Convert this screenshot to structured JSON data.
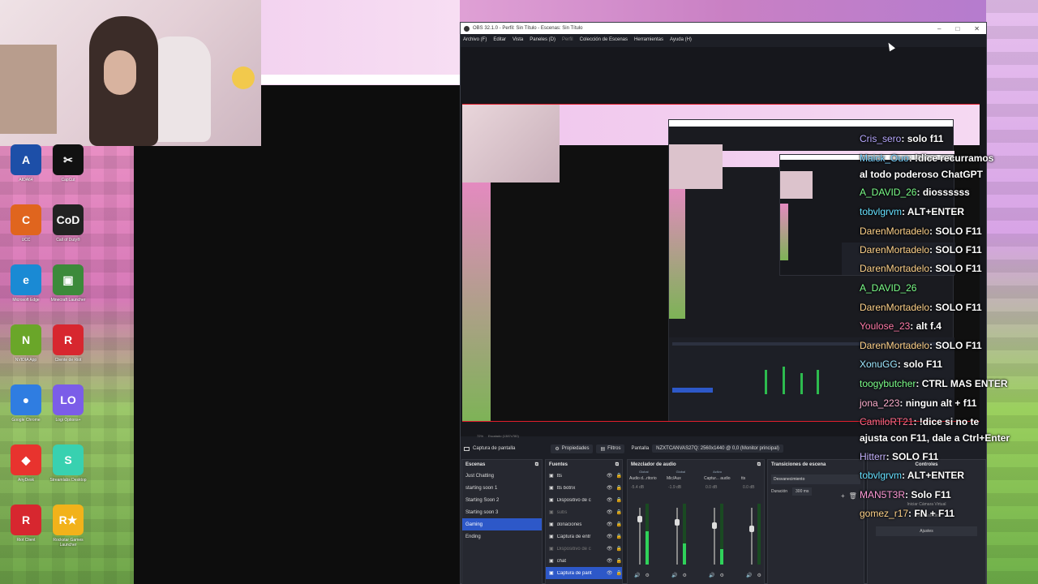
{
  "obs": {
    "title": "OBS 32.1.0 - Perfil: Sin Título - Escenas: Sin Título",
    "menu": [
      "Archivo (F)",
      "Editar",
      "Vista",
      "Paneles (D)",
      "Perfil",
      "Colección de Escenas",
      "Herramientas",
      "Ayuda (H)"
    ],
    "window_controls": [
      "–",
      "□",
      "✕"
    ],
    "status": [
      "72%",
      "Escalado (1387x780)"
    ],
    "toolbar": {
      "source_name": "Captura de pantalla",
      "properties": "Propiedades",
      "filters": "Filtros",
      "display_label": "Pantalla",
      "display_value": "NZXTCANVAS27Q: 2560x1440 @ 0,0 (Monitor principal)"
    },
    "scenes": {
      "title": "Escenas",
      "items": [
        "Just Chatting",
        "starting soon 1",
        "Starting Soon 2",
        "Starting soon 3",
        "Gaming",
        "Ending"
      ],
      "selected_index": 4
    },
    "sources": {
      "title": "Fuentes",
      "items": [
        {
          "name": "tts",
          "dim": false
        },
        {
          "name": "tts botrix",
          "dim": false
        },
        {
          "name": "Dispositivo de c",
          "dim": false
        },
        {
          "name": "subs",
          "dim": true
        },
        {
          "name": "donaciones",
          "dim": false
        },
        {
          "name": "Captura de entr",
          "dim": false
        },
        {
          "name": "Dispositivo de c",
          "dim": true
        },
        {
          "name": "chat",
          "dim": false
        },
        {
          "name": "Captura de pant",
          "dim": false
        }
      ],
      "selected_index": 8
    },
    "mixer": {
      "title": "Mezclador de audio",
      "tabs": [
        "Global",
        "Global",
        "Activo"
      ],
      "channels": [
        {
          "name": "Audio d...ritorio",
          "db": "-5.4 dB",
          "level": 0.55
        },
        {
          "name": "Mic/Aux",
          "db": "-1.9 dB",
          "level": 0.35
        },
        {
          "name": "Captur... audio",
          "db": "0.0 dB",
          "level": 0.25
        },
        {
          "name": "tts",
          "db": "0.0 dB",
          "level": 0.0
        }
      ]
    },
    "transitions": {
      "title": "Transiciones de escena",
      "type": "Desvanecimiento",
      "duration_label": "Duración",
      "duration_value": "300 ms"
    },
    "controls": {
      "title": "Controles",
      "items": [
        "Iniciar Cámara Virtual",
        "Modo Estudio",
        "Ajustes"
      ]
    }
  },
  "desktop_icons": [
    {
      "label": "AIDA64",
      "color": "#1d4fa8",
      "glyph": "A"
    },
    {
      "label": "CapCut",
      "color": "#111111",
      "glyph": "✂"
    },
    {
      "label": "UCC",
      "color": "#e0651e",
      "glyph": "C"
    },
    {
      "label": "Call of Duty®",
      "color": "#222222",
      "glyph": "CoD"
    },
    {
      "label": "Microsoft Edge",
      "color": "#1a8ad4",
      "glyph": "e"
    },
    {
      "label": "Minecraft Launcher",
      "color": "#3c8a3a",
      "glyph": "▣"
    },
    {
      "label": "NVIDIA App",
      "color": "#6aa629",
      "glyph": "N"
    },
    {
      "label": "Cliente de Riot",
      "color": "#d7272f",
      "glyph": "R"
    },
    {
      "label": "Google Chrome",
      "color": "#2f7de1",
      "glyph": "●"
    },
    {
      "label": "Logi Options+",
      "color": "#7b5de8",
      "glyph": "LO"
    },
    {
      "label": "AnyDesk",
      "color": "#e8332e",
      "glyph": "◆"
    },
    {
      "label": "Streamlabs Desktop",
      "color": "#38d1b0",
      "glyph": "S"
    },
    {
      "label": "Riot Client",
      "color": "#d7272f",
      "glyph": "R"
    },
    {
      "label": "Rockstar Games Launcher",
      "color": "#f2b21a",
      "glyph": "R★"
    }
  ],
  "chat": [
    {
      "user": "Cris_sero",
      "msg": ": solo f11",
      "color": "#b7a8ff"
    },
    {
      "user": "Maick_Ouo",
      "msg": ": !dice recurramos",
      "color": "#7ad3ff"
    },
    {
      "user": "",
      "msg": "al todo poderoso ChatGPT",
      "color": "#ffffff"
    },
    {
      "user": "A_DAVID_26",
      "msg": ": diossssss",
      "color": "#7cff8a"
    },
    {
      "user": "tobvlgrvm",
      "msg": ": ALT+ENTER",
      "color": "#66e0ff"
    },
    {
      "user": "DarenMortadelo",
      "msg": ": SOLO F11",
      "color": "#ffd28a"
    },
    {
      "user": "DarenMortadelo",
      "msg": ": SOLO F11",
      "color": "#ffd28a"
    },
    {
      "user": "DarenMortadelo",
      "msg": ": SOLO F11",
      "color": "#ffd28a"
    },
    {
      "user": "A_DAVID_26",
      "msg": "",
      "color": "#7cff8a"
    },
    {
      "user": "DarenMortadelo",
      "msg": ": SOLO F11",
      "color": "#ffd28a"
    },
    {
      "user": "Youlose_23",
      "msg": ": alt f.4",
      "color": "#ff7aa8"
    },
    {
      "user": "DarenMortadelo",
      "msg": ": SOLO F11",
      "color": "#ffd28a"
    },
    {
      "user": "XonuGG",
      "msg": ": solo F11",
      "color": "#9fe8ff"
    },
    {
      "user": "toogybutcher",
      "msg": ": CTRL MAS ENTER",
      "color": "#7cff8a"
    },
    {
      "user": "jona_223",
      "msg": ": ningun alt + f11",
      "color": "#ffb0d0"
    },
    {
      "user": "CamiloRT21",
      "msg": ": !dice si no te",
      "color": "#ff6b8a"
    },
    {
      "user": "",
      "msg": "ajusta con F11, dale a Ctrl+Enter",
      "color": "#ffffff"
    },
    {
      "user": "Hitterr",
      "msg": ": SOLO F11",
      "color": "#c6b3ff"
    },
    {
      "user": "tobvlgrvm",
      "msg": ": ALT+ENTER",
      "color": "#66e0ff"
    },
    {
      "user": "MAN5T3R",
      "msg": ": Solo F11",
      "color": "#ff9ad8"
    },
    {
      "user": "gomez_r17",
      "msg": ": FN + F11",
      "color": "#ffd38a"
    }
  ]
}
